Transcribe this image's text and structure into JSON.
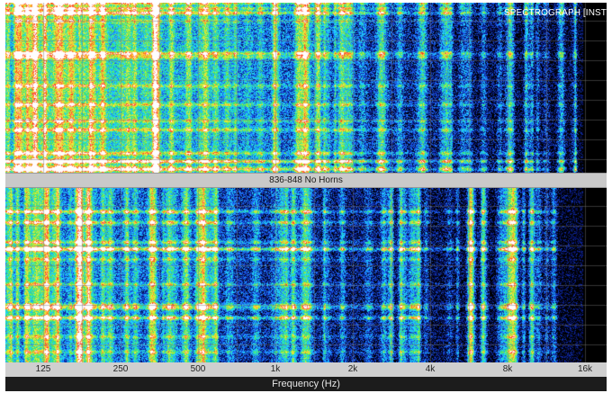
{
  "window": {
    "title": "SPECTROGRAPH [INST"
  },
  "panels": [
    {
      "label": ""
    },
    {
      "label": "836-848 No Horns"
    }
  ],
  "frequency_axis": {
    "title": "Frequency (Hz)",
    "scale": "log",
    "ticks": [
      "125",
      "250",
      "500",
      "1k",
      "2k",
      "4k",
      "8k",
      "16k"
    ]
  },
  "colors": {
    "background": "#000000",
    "grid": "#3a3a3a",
    "colormap": [
      "#000000",
      "#0a1a8c",
      "#1f6bff",
      "#1ee0ff",
      "#35e06b",
      "#c8f03a",
      "#ffe23a",
      "#ff3b1e",
      "#ffffff"
    ],
    "divider": "#c9c9c9",
    "axis_bar": "#cfcfcf"
  }
}
